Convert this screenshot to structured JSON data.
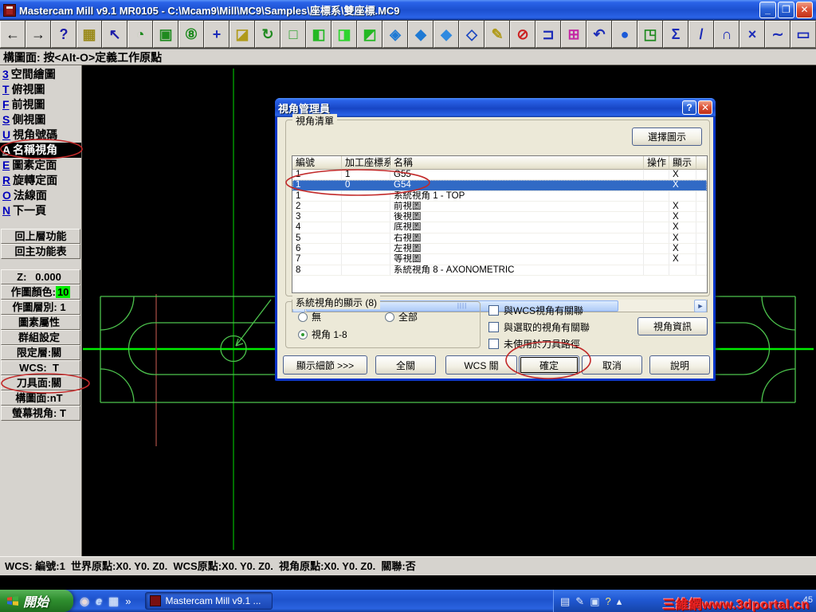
{
  "window": {
    "title": "Mastercam Mill v9.1 MR0105 - C:\\Mcam9\\Mill\\MC9\\Samples\\座標系\\雙座標.MC9",
    "minimize": "_",
    "restore": "❐",
    "close": "✕"
  },
  "toolbar": {
    "buttons": [
      {
        "name": "back-arrow-icon",
        "glyph": "←",
        "color": "#141414"
      },
      {
        "name": "forward-arrow-icon",
        "glyph": "→",
        "color": "#141414"
      },
      {
        "name": "help-icon",
        "glyph": "?",
        "color": "#1c1ca8"
      },
      {
        "name": "file-cabinet-icon",
        "glyph": "▦",
        "color": "#9a8a1a"
      },
      {
        "name": "cursor-help-icon",
        "glyph": "↖",
        "color": "#1c1ca8"
      },
      {
        "name": "zoom-dynamic-icon",
        "glyph": "◔",
        "color": "#1f8a1f"
      },
      {
        "name": "zoom-window-icon",
        "glyph": "▣",
        "color": "#1f8a1f"
      },
      {
        "name": "zoom-scale-icon",
        "glyph": "⑧",
        "color": "#1f8a1f"
      },
      {
        "name": "pan-icon",
        "glyph": "+",
        "color": "#1c2cb8"
      },
      {
        "name": "repaint-icon",
        "glyph": "◪",
        "color": "#b09a1a"
      },
      {
        "name": "rotate-view-icon",
        "glyph": "↻",
        "color": "#1f8a1f"
      },
      {
        "name": "gview-wireframe-cube-icon",
        "glyph": "□",
        "color": "#1f9e1f"
      },
      {
        "name": "gview-top-cube-icon",
        "glyph": "◧",
        "color": "#23b823"
      },
      {
        "name": "gview-front-cube-icon",
        "glyph": "◨",
        "color": "#2fd42f"
      },
      {
        "name": "gview-side-cube-icon",
        "glyph": "◩",
        "color": "#23b823"
      },
      {
        "name": "gview-iso-cube-icon",
        "glyph": "◈",
        "color": "#1f7ad4"
      },
      {
        "name": "cplane-cube-1-icon",
        "glyph": "◆",
        "color": "#1f7ad4"
      },
      {
        "name": "cplane-cube-2-icon",
        "glyph": "◆",
        "color": "#2f8ae0"
      },
      {
        "name": "cplane-cube-3-icon",
        "glyph": "◇",
        "color": "#1a46c0"
      },
      {
        "name": "pencil-icon",
        "glyph": "✎",
        "color": "#b09a1a"
      },
      {
        "name": "delete-icon",
        "glyph": "⊘",
        "color": "#cc2020"
      },
      {
        "name": "copy-icon",
        "glyph": "⊐",
        "color": "#1c2cb8"
      },
      {
        "name": "paste-icon",
        "glyph": "⊞",
        "color": "#c428a4"
      },
      {
        "name": "undo-icon",
        "glyph": "↶",
        "color": "#1c2cb8"
      },
      {
        "name": "sphere-icon",
        "glyph": "●",
        "color": "#1a5ad8"
      },
      {
        "name": "export-solids-icon",
        "glyph": "◳",
        "color": "#1f8a1f"
      },
      {
        "name": "sigma-icon",
        "glyph": "Σ",
        "color": "#1c2cb8"
      },
      {
        "name": "line-icon",
        "glyph": "/",
        "color": "#1c2cb8"
      },
      {
        "name": "arc-icon",
        "glyph": "∩",
        "color": "#1c2cb8"
      },
      {
        "name": "curve-icon",
        "glyph": "×",
        "color": "#1c2cb8"
      },
      {
        "name": "spline-icon",
        "glyph": "∼",
        "color": "#1c2cb8"
      },
      {
        "name": "rectangle-icon",
        "glyph": "▭",
        "color": "#1c2cb8"
      }
    ]
  },
  "prompt": "構圖面: 按<Alt-O>定義工作原點",
  "sidebar": {
    "menu": [
      {
        "name": "sidebar-item-3d-construction",
        "hotkey": "3",
        "label": "空間繪圖"
      },
      {
        "name": "sidebar-item-top-view",
        "hotkey": "T",
        "label": "俯視圖"
      },
      {
        "name": "sidebar-item-front-view",
        "hotkey": "F",
        "label": "前視圖"
      },
      {
        "name": "sidebar-item-side-view",
        "hotkey": "S",
        "label": "側視圖"
      },
      {
        "name": "sidebar-item-view-number",
        "hotkey": "U",
        "label": "視角號碼"
      },
      {
        "name": "sidebar-item-named-views",
        "hotkey": "A",
        "label": "名稱視角",
        "selected": true
      },
      {
        "name": "sidebar-item-entity-plane",
        "hotkey": "E",
        "label": "圖素定面"
      },
      {
        "name": "sidebar-item-rotate-plane",
        "hotkey": "R",
        "label": "旋轉定面"
      },
      {
        "name": "sidebar-item-normal-plane",
        "hotkey": "O",
        "label": "法線面"
      },
      {
        "name": "sidebar-item-next-page",
        "hotkey": "N",
        "label": "下一頁"
      }
    ],
    "nav": [
      {
        "name": "backup-button",
        "label": "回上層功能"
      },
      {
        "name": "main-menu-button",
        "label": "回主功能表"
      }
    ],
    "fields": [
      {
        "name": "z-depth-button",
        "text": "Z:   0.000"
      },
      {
        "name": "draw-color-button",
        "text": "作圖顏色:",
        "value": "10",
        "value_bg": "#00ee00"
      },
      {
        "name": "level-button",
        "text": "作圖層別: 1"
      },
      {
        "name": "attributes-button",
        "text": "圖素屬性"
      },
      {
        "name": "group-settings-button",
        "text": "群組設定"
      },
      {
        "name": "limit-level-button",
        "text": "限定層:關"
      },
      {
        "name": "wcs-button",
        "text": "WCS:  T"
      },
      {
        "name": "tool-plane-button",
        "text": "刀具面:關"
      },
      {
        "name": "construction-plane-button",
        "text": "構圖面:nT"
      },
      {
        "name": "screen-view-button",
        "text": "螢幕視角: T"
      }
    ]
  },
  "dialog": {
    "title": "視角管理員",
    "help_glyph": "?",
    "close_glyph": "✕",
    "group_title": "視角清單",
    "select_icon_button": "選擇圖示",
    "columns": [
      "編號",
      "加工座標系",
      "名稱",
      "操作",
      "顯示"
    ],
    "rows": [
      {
        "no": "1",
        "wcs": "1",
        "name": "G55",
        "op": "",
        "show": "X"
      },
      {
        "no": "1",
        "wcs": "0",
        "name": "G54",
        "op": "",
        "show": "X",
        "selected": true
      },
      {
        "no": "1",
        "wcs": "",
        "name": "系統視角 1 - TOP",
        "op": "",
        "show": ""
      },
      {
        "no": "2",
        "wcs": "",
        "name": "前視圖",
        "op": "",
        "show": "X"
      },
      {
        "no": "3",
        "wcs": "",
        "name": "後視圖",
        "op": "",
        "show": "X"
      },
      {
        "no": "4",
        "wcs": "",
        "name": "底視圖",
        "op": "",
        "show": "X"
      },
      {
        "no": "5",
        "wcs": "",
        "name": "右視圖",
        "op": "",
        "show": "X"
      },
      {
        "no": "6",
        "wcs": "",
        "name": "左視圖",
        "op": "",
        "show": "X"
      },
      {
        "no": "7",
        "wcs": "",
        "name": "等視圖",
        "op": "",
        "show": "X"
      },
      {
        "no": "8",
        "wcs": "",
        "name": "系統視角 8 - AXONOMETRIC",
        "op": "",
        "show": ""
      }
    ],
    "scroll": {
      "left": "◄",
      "right": "►",
      "grip": "||||"
    },
    "display_group": {
      "title": "系統視角的顯示 (8)",
      "radios": [
        {
          "name": "radio-none",
          "label": "無",
          "checked": false
        },
        {
          "name": "radio-all",
          "label": "全部",
          "checked": false
        },
        {
          "name": "radio-views-1-8",
          "label": "視角 1-8",
          "checked": true
        }
      ]
    },
    "checkboxes": [
      {
        "name": "checkbox-wcs-associated",
        "label": "與WCS視角有關聯"
      },
      {
        "name": "checkbox-selected-view-associated",
        "label": "與選取的視角有關聯"
      },
      {
        "name": "checkbox-not-used-toolpath",
        "label": "未使用於刀具路徑"
      }
    ],
    "info_button": "視角資訊",
    "bottom_buttons": [
      {
        "name": "display-details-button",
        "label": "顯示細節 >>>"
      },
      {
        "name": "all-off-button",
        "label": "全關"
      },
      {
        "name": "wcs-off-button",
        "label": "WCS 關"
      },
      {
        "name": "ok-button",
        "label": "確定",
        "default": true
      },
      {
        "name": "cancel-button",
        "label": "取消"
      },
      {
        "name": "help-button",
        "label": "說明"
      }
    ]
  },
  "statusbar": "WCS: 編號:1  世界原點:X0. Y0. Z0.  WCS原點:X0. Y0. Z0.  視角原點:X0. Y0. Z0.  關聯:否",
  "taskbar": {
    "start": "開始",
    "quick_launch": [
      {
        "name": "media-player-icon",
        "glyph": "◉",
        "color": "#e8d8d8"
      },
      {
        "name": "internet-explorer-icon",
        "glyph": "e",
        "color": "#bcd8ff"
      },
      {
        "name": "app-window-icon",
        "glyph": "▦",
        "color": "#cfe0f8"
      }
    ],
    "overflow": "»",
    "task_button": "Mastercam Mill v9.1 ...",
    "tray_icons": [
      {
        "name": "keyboard-icon",
        "glyph": "▤",
        "color": "#e8eef8"
      },
      {
        "name": "pen-icon",
        "glyph": "✎",
        "color": "#e8eef8"
      },
      {
        "name": "ime-pad-icon",
        "glyph": "▣",
        "color": "#cfe0f8"
      },
      {
        "name": "tray-help-icon",
        "glyph": "?",
        "color": "#f4e27a"
      },
      {
        "name": "hide-tray-icon",
        "glyph": "▴",
        "color": "#e8eef8"
      }
    ],
    "watermark": "三維網www.3dportal.cn",
    "clock_partial": "45"
  }
}
